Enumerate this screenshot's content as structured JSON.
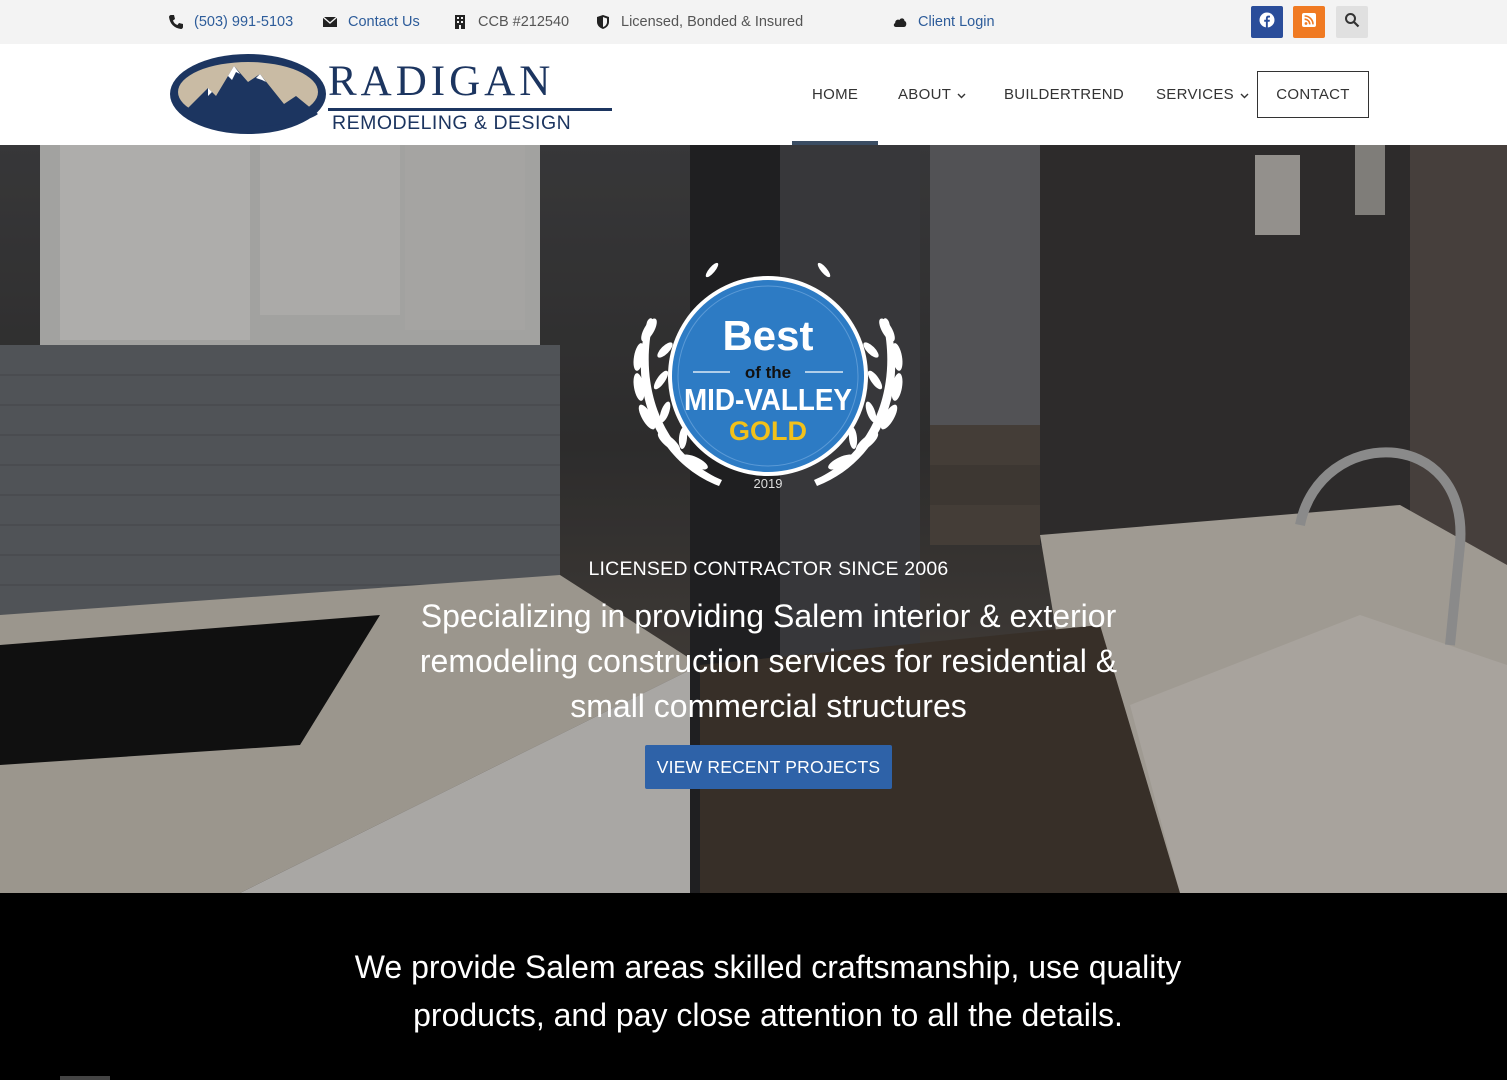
{
  "topbar": {
    "phone": "(503) 991-5103",
    "contact": "Contact Us",
    "ccb": "CCB #212540",
    "licensed": "Licensed, Bonded & Insured",
    "client_login": "Client Login",
    "icons": [
      "phone-icon",
      "envelope-icon",
      "building-icon",
      "shield-icon",
      "cloud-icon",
      "facebook-icon",
      "rss-icon",
      "search-icon"
    ],
    "colors": {
      "facebook": "#2a4d9a",
      "rss": "#f07a22",
      "link": "#2d5c9a"
    }
  },
  "logo": {
    "name": "RADIGAN",
    "sub": "REMODELING & DESIGN"
  },
  "nav": {
    "home": "HOME",
    "about": "ABOUT",
    "buildertrend": "BUILDERTREND",
    "services": "SERVICES",
    "contact": "CONTACT",
    "active": "HOME"
  },
  "hero": {
    "badge": {
      "line1": "Best",
      "line2": "of the",
      "line3": "MID-VALLEY",
      "line4": "GOLD",
      "year": "2019"
    },
    "kicker": "LICENSED CONTRACTOR SINCE 2006",
    "title": "Specializing in providing Salem interior & exterior remodeling construction services for residential & small commercial structures",
    "button": "VIEW RECENT PROJECTS",
    "button_color": "#2e62a8"
  },
  "intro": {
    "text": "We provide Salem areas skilled craftsmanship, use quality products, and pay close attention to all the details."
  }
}
